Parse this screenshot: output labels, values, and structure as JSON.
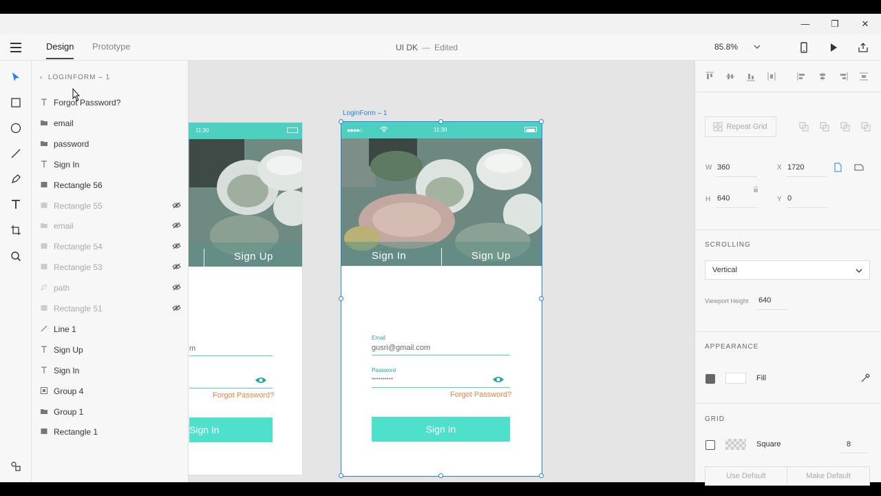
{
  "window": {
    "minimize": "—",
    "restore": "❐",
    "close": "✕"
  },
  "toolbar": {
    "tabs": [
      "Design",
      "Prototype"
    ],
    "doc_title": "UI DK",
    "separator": "—",
    "status": "Edited",
    "zoom": "85.8%"
  },
  "layers": {
    "header": "LOGINFORM – 1",
    "items": [
      {
        "name": "Forgot Password?",
        "icon": "text-icon",
        "hidden": false
      },
      {
        "name": "email",
        "icon": "folder-icon",
        "hidden": false
      },
      {
        "name": "password",
        "icon": "folder-icon",
        "hidden": false
      },
      {
        "name": "Sign In",
        "icon": "text-icon",
        "hidden": false
      },
      {
        "name": "Rectangle 56",
        "icon": "rectangle-icon",
        "hidden": false
      },
      {
        "name": "Rectangle 55",
        "icon": "rectangle-icon",
        "hidden": true
      },
      {
        "name": "email",
        "icon": "folder-icon",
        "hidden": true
      },
      {
        "name": "Rectangle 54",
        "icon": "rectangle-icon",
        "hidden": true
      },
      {
        "name": "Rectangle 53",
        "icon": "rectangle-icon",
        "hidden": true
      },
      {
        "name": "path",
        "icon": "pen-icon",
        "hidden": true
      },
      {
        "name": "Rectangle 51",
        "icon": "rectangle-icon",
        "hidden": true
      },
      {
        "name": "Line 1",
        "icon": "line-icon",
        "hidden": false
      },
      {
        "name": "Sign Up",
        "icon": "text-icon",
        "hidden": false
      },
      {
        "name": "Sign In",
        "icon": "text-icon",
        "hidden": false
      },
      {
        "name": "Group 4",
        "icon": "group-icon",
        "hidden": false
      },
      {
        "name": "Group 1",
        "icon": "folder-icon",
        "hidden": false
      },
      {
        "name": "Rectangle 1",
        "icon": "rectangle-icon",
        "hidden": false
      }
    ]
  },
  "canvas": {
    "artboard_label": "LoginForm – 1",
    "left_artboard": {
      "time": "11:30",
      "tab_signup": "Sign Up",
      "email_fragment": "m",
      "forgot": "Forgot Password?",
      "signin_btn": "Sign In"
    },
    "main_artboard": {
      "time": "11:30",
      "tab_signin": "Sign In",
      "tab_signup": "Sign Up",
      "email_label": "Email",
      "email_value": "gusri@gmail.com",
      "password_label": "Password",
      "password_value": "**********",
      "forgot": "Forgot Password?",
      "signin_btn": "Sign In"
    }
  },
  "properties": {
    "repeat_grid": "Repeat Grid",
    "w_label": "W",
    "w_value": "360",
    "h_label": "H",
    "h_value": "640",
    "x_label": "X",
    "x_value": "1720",
    "y_label": "Y",
    "y_value": "0",
    "scrolling_title": "SCROLLING",
    "scrolling_value": "Vertical",
    "viewport_label": "Viewport Height",
    "viewport_value": "640",
    "appearance_title": "APPEARANCE",
    "fill_label": "Fill",
    "grid_title": "GRID",
    "grid_type": "Square",
    "grid_size": "8",
    "use_default": "Use Default",
    "make_default": "Make Default"
  },
  "colors": {
    "accent": "#2680eb",
    "teal": "#4dd0c0",
    "button": "#4fe0cc",
    "forgot": "#e8824a"
  }
}
